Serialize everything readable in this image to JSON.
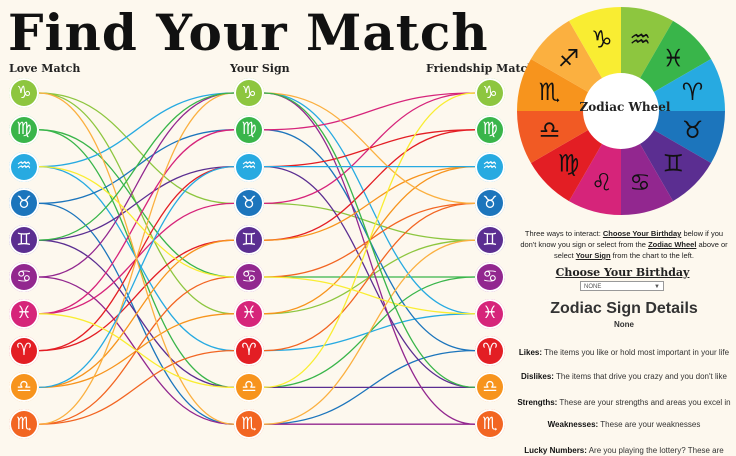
{
  "title": "Find Your Match",
  "columns": {
    "love": "Love Match",
    "sign": "Your Sign",
    "friend": "Friendship Match"
  },
  "badges": [
    {
      "name": "capricorn",
      "color": "#8dc63f",
      "glyph": "♑"
    },
    {
      "name": "virgo",
      "color": "#39b54a",
      "glyph": "♍"
    },
    {
      "name": "aquarius",
      "color": "#27aae1",
      "glyph": "♒"
    },
    {
      "name": "taurus",
      "color": "#1c75bc",
      "glyph": "♉"
    },
    {
      "name": "gemini",
      "color": "#5b2e91",
      "glyph": "♊"
    },
    {
      "name": "cancer",
      "color": "#92278f",
      "glyph": "♋"
    },
    {
      "name": "pisces",
      "color": "#d6247a",
      "glyph": "♓"
    },
    {
      "name": "aries",
      "color": "#e31e24",
      "glyph": "♈"
    },
    {
      "name": "libra",
      "color": "#f7941d",
      "glyph": "♎"
    },
    {
      "name": "scorpio",
      "color": "#f26522",
      "glyph": "♏"
    }
  ],
  "links": [
    {
      "from": 0,
      "to": 3,
      "color": "#8dc63f"
    },
    {
      "from": 0,
      "to": 6,
      "color": "#8dc63f"
    },
    {
      "from": 1,
      "to": 5,
      "color": "#39b54a"
    },
    {
      "from": 1,
      "to": 8,
      "color": "#39b54a"
    },
    {
      "from": 2,
      "to": 0,
      "color": "#27aae1"
    },
    {
      "from": 2,
      "to": 7,
      "color": "#27aae1"
    },
    {
      "from": 3,
      "to": 1,
      "color": "#1c75bc"
    },
    {
      "from": 3,
      "to": 9,
      "color": "#1c75bc"
    },
    {
      "from": 4,
      "to": 2,
      "color": "#5b2e91"
    },
    {
      "from": 4,
      "to": 8,
      "color": "#5b2e91"
    },
    {
      "from": 5,
      "to": 0,
      "color": "#92278f"
    },
    {
      "from": 5,
      "to": 9,
      "color": "#92278f"
    },
    {
      "from": 6,
      "to": 3,
      "color": "#d6247a"
    },
    {
      "from": 6,
      "to": 1,
      "color": "#d6247a"
    },
    {
      "from": 7,
      "to": 4,
      "color": "#e31e24"
    },
    {
      "from": 7,
      "to": 2,
      "color": "#e31e24"
    },
    {
      "from": 8,
      "to": 6,
      "color": "#f7941d"
    },
    {
      "from": 8,
      "to": 4,
      "color": "#f7941d"
    },
    {
      "from": 9,
      "to": 5,
      "color": "#f26522"
    },
    {
      "from": 9,
      "to": 7,
      "color": "#f26522"
    },
    {
      "from": 0,
      "to": 9,
      "color": "#fbb040"
    },
    {
      "from": 9,
      "to": 0,
      "color": "#fbb040"
    },
    {
      "from": 2,
      "to": 5,
      "color": "#f9ed32"
    },
    {
      "from": 6,
      "to": 8,
      "color": "#f9ed32"
    },
    {
      "from": 4,
      "to": 0,
      "color": "#39b54a"
    },
    {
      "from": 8,
      "to": 2,
      "color": "#27aae1"
    }
  ],
  "wheel": {
    "label": "Zodiac Wheel",
    "segments": [
      {
        "name": "aquarius",
        "color": "#8dc63f",
        "glyph": "♒"
      },
      {
        "name": "pisces",
        "color": "#39b54a",
        "glyph": "♓"
      },
      {
        "name": "aries",
        "color": "#27aae1",
        "glyph": "♈"
      },
      {
        "name": "taurus",
        "color": "#1c75bc",
        "glyph": "♉"
      },
      {
        "name": "gemini",
        "color": "#5b2e91",
        "glyph": "♊"
      },
      {
        "name": "cancer",
        "color": "#92278f",
        "glyph": "♋"
      },
      {
        "name": "leo",
        "color": "#d6247a",
        "glyph": "♌"
      },
      {
        "name": "virgo",
        "color": "#e31e24",
        "glyph": "♍"
      },
      {
        "name": "libra",
        "color": "#f15a24",
        "glyph": "♎"
      },
      {
        "name": "scorpio",
        "color": "#f7941d",
        "glyph": "♏"
      },
      {
        "name": "sagittarius",
        "color": "#fbb040",
        "glyph": "♐"
      },
      {
        "name": "capricorn",
        "color": "#f9ed32",
        "glyph": "♑"
      }
    ]
  },
  "info": {
    "p1": "Three ways to interact: ",
    "l1": "Choose Your Birthday",
    "p2": " below if you don't know you sign or select from the ",
    "l2": "Zodiac Wheel",
    "p3": " above or select ",
    "l3": "Your Sign",
    "p4": " from the chart to the left."
  },
  "birthday": {
    "label": "Choose Your Birthday",
    "value": "NONE",
    "caret": "▼"
  },
  "details": {
    "title": "Zodiac Sign Details",
    "sign": "None",
    "likes_label": "Likes:",
    "likes": " The items you like or hold most important in your life",
    "dislikes_label": "Dislikes:",
    "dislikes": " The items that drive you crazy and you don't like",
    "strengths_label": "Strengths:",
    "strengths": " These are your strengths and areas you excel in",
    "weaknesses_label": "Weaknesses:",
    "weaknesses": " These are your weaknesses",
    "lucky_label": "Lucky Numbers:",
    "lucky": " Are you playing the lottery? These are"
  }
}
